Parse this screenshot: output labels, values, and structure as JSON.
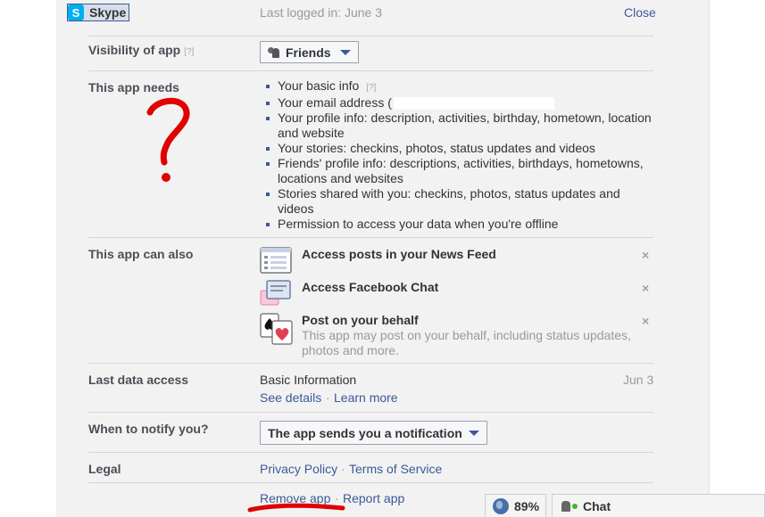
{
  "header": {
    "app_name": "Skype",
    "app_icon": "skype-icon",
    "last_login": "Last logged in: June 3",
    "close_label": "Close"
  },
  "visibility": {
    "label": "Visibility of app",
    "help": "[?]",
    "dropdown_value": "Friends"
  },
  "needs": {
    "label": "This app needs",
    "items": [
      "Your basic info",
      "Your email address (",
      "Your profile info: description, activities, birthday, hometown, location and website",
      "Your stories: checkins, photos, status updates and videos",
      "Friends' profile info: descriptions, activities, birthdays, hometowns, locations and websites",
      "Stories shared with you: checkins, photos, status updates and videos",
      "Permission to access your data when you're offline"
    ],
    "help": "[?]"
  },
  "can_also": {
    "label": "This app can also",
    "items": [
      {
        "title": "Access posts in your News Feed",
        "icon": "news-feed-icon"
      },
      {
        "title": "Access Facebook Chat",
        "icon": "chat-bubbles-icon"
      },
      {
        "title": "Post on your behalf",
        "icon": "playing-cards-icon",
        "desc": "This app may post on your behalf, including status updates, photos and more."
      }
    ],
    "remove_glyph": "×"
  },
  "last_data_access": {
    "label": "Last data access",
    "value": "Basic Information",
    "date": "Jun 3",
    "see_details": "See details",
    "sep": "·",
    "learn_more": "Learn more"
  },
  "notify": {
    "label": "When to notify you?",
    "dropdown_value": "The app sends you a notification"
  },
  "legal": {
    "label": "Legal",
    "privacy": "Privacy Policy",
    "sep": "·",
    "terms": "Terms of Service"
  },
  "footer": {
    "remove_app": "Remove app",
    "sep": "·",
    "report_app": "Report app"
  },
  "bottom_bar": {
    "percent": "89%",
    "chat": "Chat"
  },
  "annotations": {
    "question_mark": "?"
  },
  "colors": {
    "link": "#3b5998",
    "annotation_red": "#e00000",
    "skype_blue": "#00aff0"
  }
}
